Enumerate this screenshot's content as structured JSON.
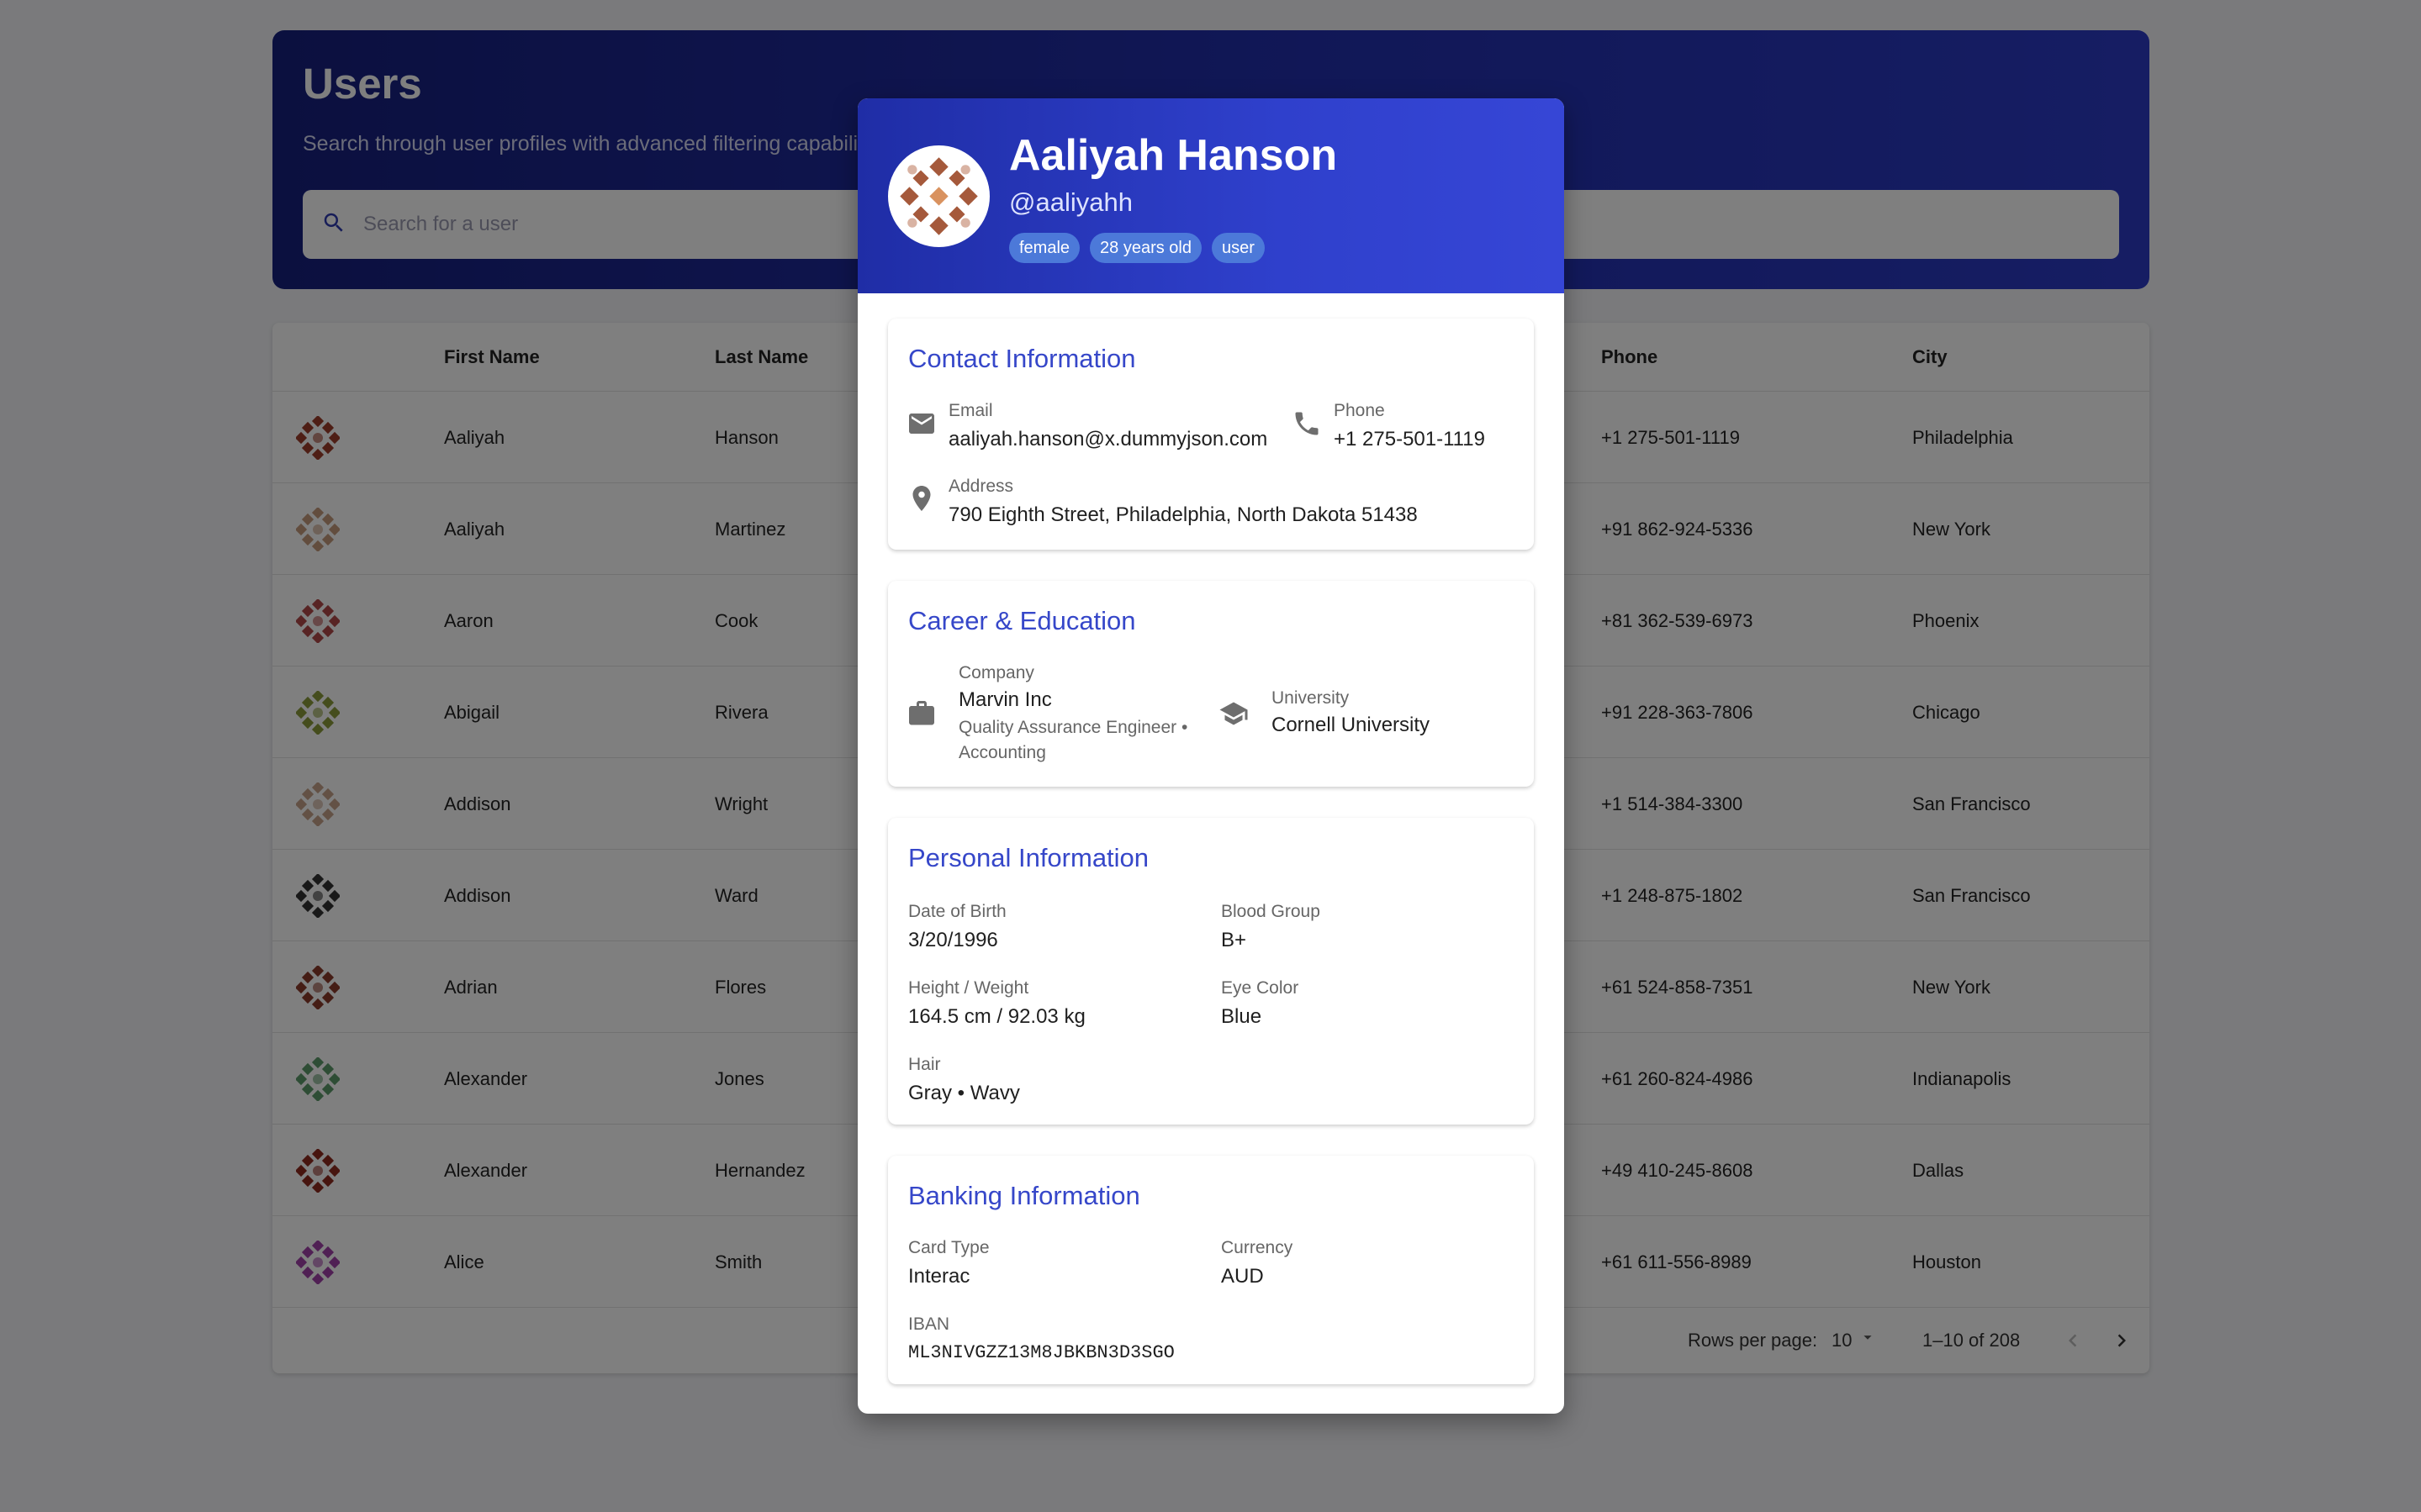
{
  "header": {
    "title": "Users",
    "subtitle": "Search through user profiles with advanced filtering capabilities",
    "search_placeholder": "Search for a user"
  },
  "table": {
    "columns": [
      "First Name",
      "Last Name",
      "Phone",
      "City"
    ],
    "rows": [
      {
        "first": "Aaliyah",
        "last": "Hanson",
        "phone": "+1 275-501-1119",
        "city": "Philadelphia",
        "avatar_color": "#9c3d2a"
      },
      {
        "first": "Aaliyah",
        "last": "Martinez",
        "phone": "+91 862-924-5336",
        "city": "New York",
        "avatar_color": "#c59a7d"
      },
      {
        "first": "Aaron",
        "last": "Cook",
        "phone": "+81 362-539-6973",
        "city": "Phoenix",
        "avatar_color": "#b04848"
      },
      {
        "first": "Abigail",
        "last": "Rivera",
        "phone": "+91 228-363-7806",
        "city": "Chicago",
        "avatar_color": "#8a9a3a"
      },
      {
        "first": "Addison",
        "last": "Wright",
        "phone": "+1 514-384-3300",
        "city": "San Francisco",
        "avatar_color": "#c7a28a"
      },
      {
        "first": "Addison",
        "last": "Ward",
        "phone": "+1 248-875-1802",
        "city": "San Francisco",
        "avatar_color": "#333333"
      },
      {
        "first": "Adrian",
        "last": "Flores",
        "phone": "+61 524-858-7351",
        "city": "New York",
        "avatar_color": "#8b3a2a"
      },
      {
        "first": "Alexander",
        "last": "Jones",
        "phone": "+61 260-824-4986",
        "city": "Indianapolis",
        "avatar_color": "#5d9a6a"
      },
      {
        "first": "Alexander",
        "last": "Hernandez",
        "phone": "+49 410-245-8608",
        "city": "Dallas",
        "avatar_color": "#8e2a1e"
      },
      {
        "first": "Alice",
        "last": "Smith",
        "phone": "+61 611-556-8989",
        "city": "Houston",
        "avatar_color": "#a040a8"
      }
    ],
    "footer": {
      "rows_per_page_label": "Rows per page:",
      "rows_per_page_value": "10",
      "range": "1–10 of 208"
    }
  },
  "modal": {
    "name": "Aaliyah Hanson",
    "username": "@aaliyahh",
    "chips": [
      "female",
      "28 years old",
      "user"
    ],
    "contact": {
      "title": "Contact Information",
      "email_label": "Email",
      "email": "aaliyah.hanson@x.dummyjson.com",
      "phone_label": "Phone",
      "phone": "+1 275-501-1119",
      "address_label": "Address",
      "address": "790 Eighth Street, Philadelphia, North Dakota 51438"
    },
    "career": {
      "title": "Career & Education",
      "company_label": "Company",
      "company": "Marvin Inc",
      "role": "Quality Assurance Engineer • Accounting",
      "university_label": "University",
      "university": "Cornell University"
    },
    "personal": {
      "title": "Personal Information",
      "dob_label": "Date of Birth",
      "dob": "3/20/1996",
      "blood_label": "Blood Group",
      "blood": "B+",
      "hw_label": "Height / Weight",
      "hw": "164.5 cm / 92.03 kg",
      "eye_label": "Eye Color",
      "eye": "Blue",
      "hair_label": "Hair",
      "hair": "Gray • Wavy"
    },
    "banking": {
      "title": "Banking Information",
      "card_label": "Card Type",
      "card": "Interac",
      "currency_label": "Currency",
      "currency": "AUD",
      "iban_label": "IBAN",
      "iban": "ML3NIVGZZ13M8JBKBN3D3SGO"
    }
  }
}
